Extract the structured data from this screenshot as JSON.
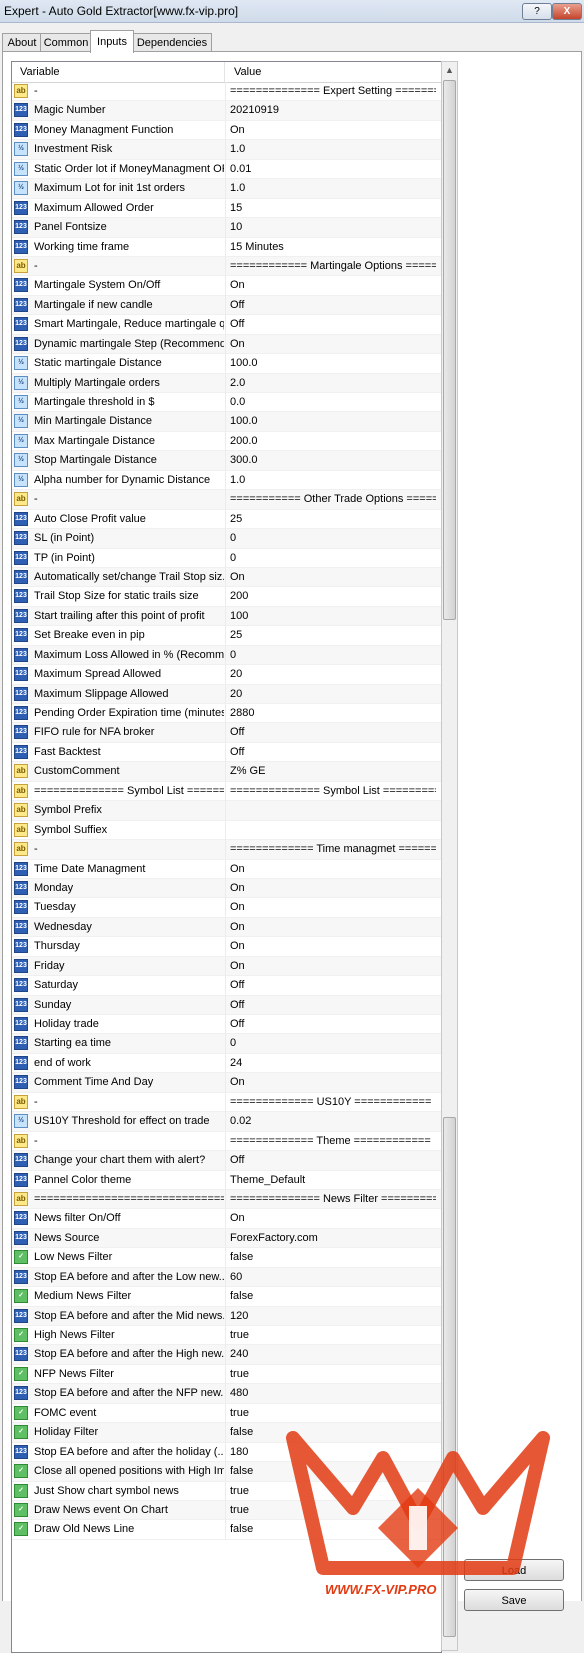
{
  "window": {
    "title": "Expert - Auto Gold Extractor[www.fx-vip.pro]",
    "help_label": "?",
    "close_label": "X"
  },
  "tabs": [
    {
      "label": "About"
    },
    {
      "label": "Common"
    },
    {
      "label": "Inputs"
    },
    {
      "label": "Dependencies"
    }
  ],
  "grid": {
    "columns": {
      "variable": "Variable",
      "value": "Value"
    },
    "rows": [
      {
        "icon": "ab",
        "variable": "-",
        "value": "============== Expert Setting ========..."
      },
      {
        "icon": "123",
        "variable": "Magic Number",
        "value": "20210919"
      },
      {
        "icon": "123",
        "variable": "Money Managment Function",
        "value": "On"
      },
      {
        "icon": "1/2",
        "variable": "Investment Risk",
        "value": "1.0"
      },
      {
        "icon": "1/2",
        "variable": "Static Order lot if MoneyManagment OFF",
        "value": "0.01"
      },
      {
        "icon": "1/2",
        "variable": "Maximum Lot for init 1st orders",
        "value": "1.0"
      },
      {
        "icon": "123",
        "variable": "Maximum Allowed Order",
        "value": "15"
      },
      {
        "icon": "123",
        "variable": "Panel Fontsize",
        "value": "10"
      },
      {
        "icon": "123",
        "variable": "Working time frame",
        "value": "15 Minutes"
      },
      {
        "icon": "ab",
        "variable": "-",
        "value": "============ Martingale Options ======..."
      },
      {
        "icon": "123",
        "variable": "Martingale System On/Off",
        "value": "On"
      },
      {
        "icon": "123",
        "variable": "Martingale if new candle",
        "value": "Off"
      },
      {
        "icon": "123",
        "variable": "Smart Martingale, Reduce martingale q...",
        "value": "Off"
      },
      {
        "icon": "123",
        "variable": "Dynamic martingale Step (Recommend...",
        "value": "On"
      },
      {
        "icon": "1/2",
        "variable": "Static martingale Distance",
        "value": "100.0"
      },
      {
        "icon": "1/2",
        "variable": "Multiply Martingale orders",
        "value": "2.0"
      },
      {
        "icon": "1/2",
        "variable": "Martingale threshold in $",
        "value": "0.0"
      },
      {
        "icon": "1/2",
        "variable": "Min Martingale Distance",
        "value": "100.0"
      },
      {
        "icon": "1/2",
        "variable": "Max Martingale Distance",
        "value": "200.0"
      },
      {
        "icon": "1/2",
        "variable": "Stop Martingale Distance",
        "value": "300.0"
      },
      {
        "icon": "1/2",
        "variable": "Alpha number for Dynamic Distance",
        "value": "1.0"
      },
      {
        "icon": "ab",
        "variable": "-",
        "value": "=========== Other Trade Options =====..."
      },
      {
        "icon": "123",
        "variable": "Auto Close Profit value",
        "value": "25"
      },
      {
        "icon": "123",
        "variable": "SL (in Point)",
        "value": "0"
      },
      {
        "icon": "123",
        "variable": "TP (in Point)",
        "value": "0"
      },
      {
        "icon": "123",
        "variable": "Automatically set/change Trail Stop siz...",
        "value": "On"
      },
      {
        "icon": "123",
        "variable": "Trail Stop Size for static trails size",
        "value": "200"
      },
      {
        "icon": "123",
        "variable": "Start trailing after this point of profit",
        "value": "100"
      },
      {
        "icon": "123",
        "variable": "Set Breake even in pip",
        "value": "25"
      },
      {
        "icon": "123",
        "variable": "Maximum Loss Allowed in % (Recomm...",
        "value": "0"
      },
      {
        "icon": "123",
        "variable": "Maximum Spread Allowed",
        "value": "20"
      },
      {
        "icon": "123",
        "variable": "Maximum Slippage Allowed",
        "value": "20"
      },
      {
        "icon": "123",
        "variable": "Pending Order Expiration time (minutes)",
        "value": "2880"
      },
      {
        "icon": "123",
        "variable": "FIFO rule for NFA broker",
        "value": "Off"
      },
      {
        "icon": "123",
        "variable": "Fast Backtest",
        "value": "Off"
      },
      {
        "icon": "ab",
        "variable": "CustomComment",
        "value": "Z% GE"
      },
      {
        "icon": "ab",
        "variable": "============== Symbol List ======...",
        "value": "============== Symbol List =========..."
      },
      {
        "icon": "ab",
        "variable": "Symbol Prefix",
        "value": ""
      },
      {
        "icon": "ab",
        "variable": "Symbol Suffiex",
        "value": ""
      },
      {
        "icon": "ab",
        "variable": "-",
        "value": "============= Time managmet =======..."
      },
      {
        "icon": "123",
        "variable": "Time Date Managment",
        "value": "On"
      },
      {
        "icon": "123",
        "variable": "Monday",
        "value": "On"
      },
      {
        "icon": "123",
        "variable": "Tuesday",
        "value": "On"
      },
      {
        "icon": "123",
        "variable": "Wednesday",
        "value": "On"
      },
      {
        "icon": "123",
        "variable": "Thursday",
        "value": "On"
      },
      {
        "icon": "123",
        "variable": "Friday",
        "value": "On"
      },
      {
        "icon": "123",
        "variable": "Saturday",
        "value": "Off"
      },
      {
        "icon": "123",
        "variable": "Sunday",
        "value": "Off"
      },
      {
        "icon": "123",
        "variable": "Holiday trade",
        "value": "Off"
      },
      {
        "icon": "123",
        "variable": "Starting ea time",
        "value": "0"
      },
      {
        "icon": "123",
        "variable": "end of work",
        "value": "24"
      },
      {
        "icon": "123",
        "variable": "Comment Time And Day",
        "value": "On"
      },
      {
        "icon": "ab",
        "variable": "-",
        "value": "============= US10Y ============"
      },
      {
        "icon": "1/2",
        "variable": "US10Y Threshold for effect on trade",
        "value": "0.02"
      },
      {
        "icon": "ab",
        "variable": "-",
        "value": "============= Theme ============"
      },
      {
        "icon": "123",
        "variable": "Change your  chart them with alert?",
        "value": "Off"
      },
      {
        "icon": "123",
        "variable": "Pannel Color theme",
        "value": "Theme_Default"
      },
      {
        "icon": "ab",
        "variable": "================================...",
        "value": "============== News Filter  =========..."
      },
      {
        "icon": "123",
        "variable": "News filter On/Off",
        "value": "On"
      },
      {
        "icon": "123",
        "variable": "News Source",
        "value": "ForexFactory.com"
      },
      {
        "icon": "bool",
        "variable": "Low News Filter",
        "value": "false"
      },
      {
        "icon": "123",
        "variable": "Stop EA before and after the Low new...",
        "value": "60"
      },
      {
        "icon": "bool",
        "variable": "Medium News Filter",
        "value": "false"
      },
      {
        "icon": "123",
        "variable": "Stop EA before and after the Mid news...",
        "value": "120"
      },
      {
        "icon": "bool",
        "variable": "High News Filter",
        "value": "true"
      },
      {
        "icon": "123",
        "variable": "Stop EA before and after the High new...",
        "value": "240"
      },
      {
        "icon": "bool",
        "variable": "NFP News Filter",
        "value": "true"
      },
      {
        "icon": "123",
        "variable": "Stop EA before and after the NFP new...",
        "value": "480"
      },
      {
        "icon": "bool",
        "variable": "FOMC event",
        "value": "true"
      },
      {
        "icon": "bool",
        "variable": "Holiday Filter",
        "value": "false"
      },
      {
        "icon": "123",
        "variable": "Stop EA before and after the holiday (...",
        "value": "180"
      },
      {
        "icon": "bool",
        "variable": "Close all opened positions with High Im...",
        "value": "false"
      },
      {
        "icon": "bool",
        "variable": "Just Show chart symbol news",
        "value": "true"
      },
      {
        "icon": "bool",
        "variable": "Draw News event On Chart",
        "value": "true"
      },
      {
        "icon": "bool",
        "variable": "Draw Old News Line",
        "value": "false"
      }
    ]
  },
  "buttons": {
    "load": "Load",
    "save": "Save"
  },
  "watermark": {
    "text": "WWW.FX-VIP.PRO",
    "color": "#e23a12"
  },
  "colors": {
    "accent_red": "#e23a12",
    "titlebar": "#cfdbea"
  }
}
